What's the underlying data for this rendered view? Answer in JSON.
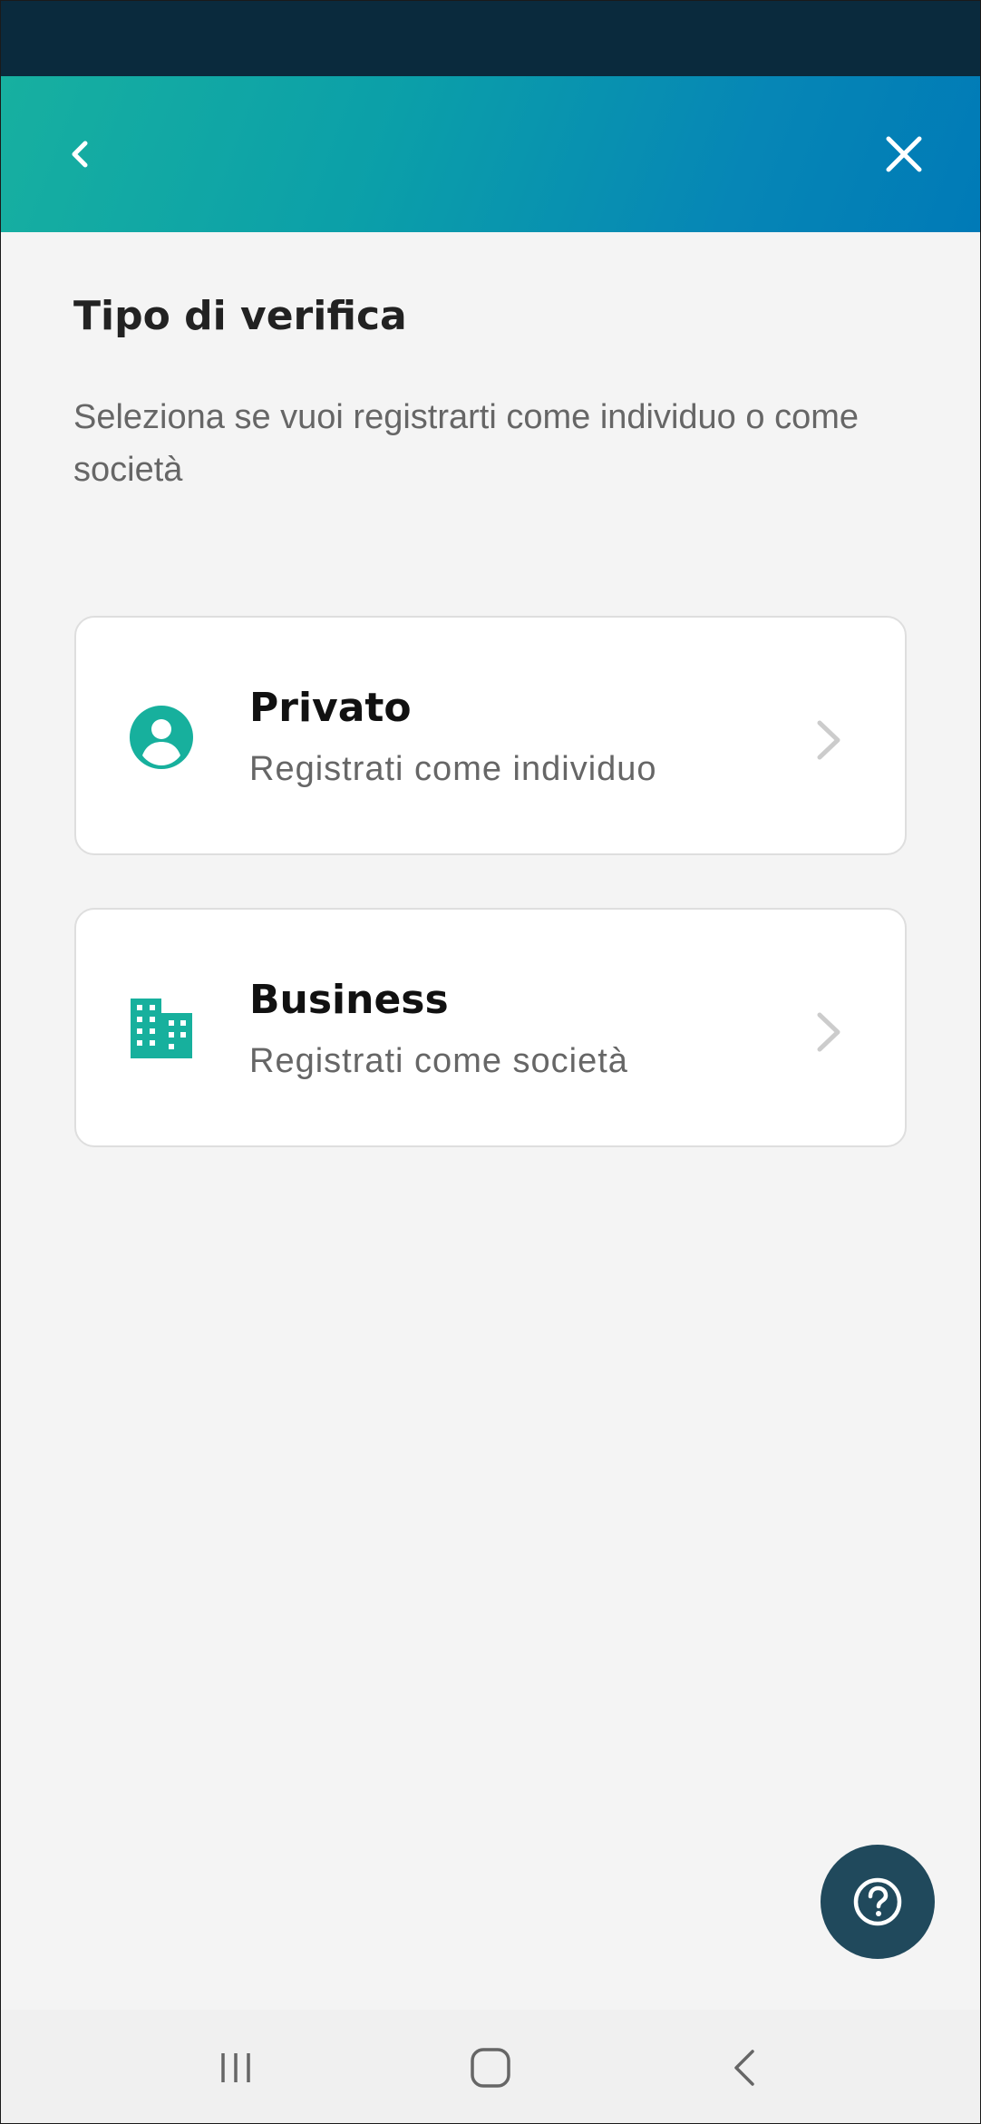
{
  "header": {
    "back_icon": "chevron-left-icon",
    "close_icon": "close-icon",
    "gradient_start": "#17b0a0",
    "gradient_end": "#007ab7"
  },
  "page": {
    "title": "Tipo di verifica",
    "subtitle": "Seleziona se vuoi registrarti come individuo o come società"
  },
  "options": [
    {
      "title": "Privato",
      "subtitle": "Registrati come individuo",
      "icon": "person-icon"
    },
    {
      "title": "Business",
      "subtitle": "Registrati come società",
      "icon": "building-icon"
    }
  ],
  "colors": {
    "accent": "#17b09d",
    "status_bar": "#0a2a3d",
    "fab": "#20495c",
    "background": "#f4f4f4"
  },
  "help_button": {
    "icon": "help-icon"
  },
  "system_nav": {
    "recents_icon": "recents-icon",
    "home_icon": "home-icon",
    "back_icon": "back-icon"
  }
}
